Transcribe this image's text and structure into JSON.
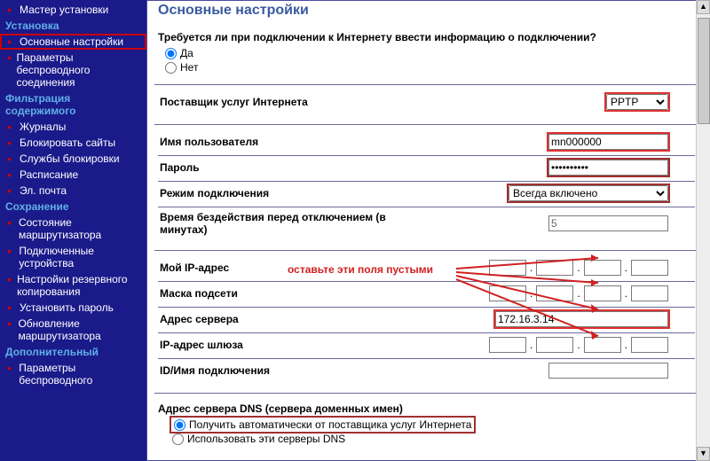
{
  "sidebar": {
    "wizard": "Мастер установки",
    "g1": "Установка",
    "items1": [
      {
        "label": "Основные настройки",
        "sel": true
      },
      {
        "label": "Параметры беспроводного соединения"
      }
    ],
    "g2": "Фильтрация содержимого",
    "items2": [
      {
        "label": "Журналы"
      },
      {
        "label": "Блокировать сайты"
      },
      {
        "label": "Службы блокировки"
      },
      {
        "label": "Расписание"
      },
      {
        "label": "Эл. почта"
      }
    ],
    "g3": "Сохранение",
    "items3": [
      {
        "label": "Состояние маршрутизатора"
      },
      {
        "label": "Подключенные устройства"
      },
      {
        "label": "Настройки резервного копирования"
      },
      {
        "label": "Установить пароль"
      },
      {
        "label": "Обновление маршрутизатора"
      }
    ],
    "g4": "Дополнительный",
    "items4": [
      {
        "label": "Параметры беспроводного"
      }
    ]
  },
  "page": {
    "title": "Основные настройки",
    "loginreq": {
      "question": "Требуется ли при подключении к Интернету ввести информацию о подключении?",
      "yes": "Да",
      "no": "Нет"
    },
    "provider": {
      "label": "Поставщик услуг Интернета",
      "value": "PPTP"
    },
    "fields": {
      "user_label": "Имя пользователя",
      "user_value": "mn000000",
      "pass_label": "Пароль",
      "pass_value": "••••••••••",
      "mode_label": "Режим подключения",
      "mode_value": "Всегда включено",
      "idle_label": "Время бездействия перед отключением (в минутах)",
      "idle_value": "5"
    },
    "ip": {
      "myip": "Мой IP-адрес",
      "mask": "Маска подсети",
      "server": "Адрес сервера",
      "server_value": "172.16.3.14",
      "gateway": "IP-адрес шлюза",
      "connid": "ID/Имя подключения"
    },
    "hint": "оставьте эти поля пустыми",
    "dns": {
      "title": "Адрес сервера DNS (сервера доменных имен)",
      "auto": "Получить автоматически от поставщика услуг Интернета",
      "manual": "Использовать эти серверы DNS"
    }
  }
}
